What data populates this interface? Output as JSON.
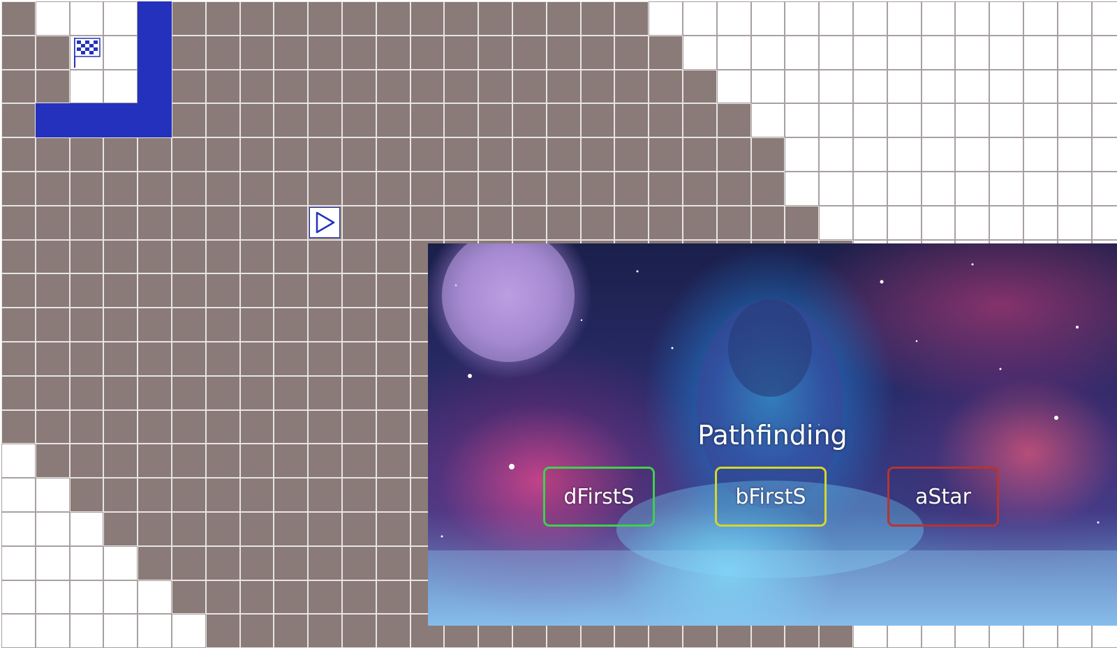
{
  "game": {
    "grid": {
      "cols": 33,
      "rows": 19,
      "visited_color": "#8a7b78",
      "open_color": "#ffffff",
      "wall_color": "#2431bd",
      "walls": [
        [
          4,
          0
        ],
        [
          4,
          1
        ],
        [
          4,
          2
        ],
        [
          1,
          3
        ],
        [
          2,
          3
        ],
        [
          3,
          3
        ],
        [
          4,
          3
        ]
      ],
      "visited_rows": [
        {
          "row": 0,
          "ranges": [
            [
              0,
              0
            ],
            [
              5,
              18
            ]
          ]
        },
        {
          "row": 1,
          "ranges": [
            [
              0,
              1
            ],
            [
              5,
              19
            ]
          ]
        },
        {
          "row": 2,
          "ranges": [
            [
              0,
              1
            ],
            [
              5,
              20
            ]
          ]
        },
        {
          "row": 3,
          "ranges": [
            [
              0,
              0
            ],
            [
              5,
              21
            ]
          ]
        },
        {
          "row": 4,
          "ranges": [
            [
              0,
              22
            ]
          ]
        },
        {
          "row": 5,
          "ranges": [
            [
              0,
              22
            ]
          ]
        },
        {
          "row": 6,
          "ranges": [
            [
              0,
              23
            ]
          ]
        },
        {
          "row": 7,
          "ranges": [
            [
              0,
              24
            ]
          ]
        },
        {
          "row": 8,
          "ranges": [
            [
              0,
              24
            ]
          ]
        },
        {
          "row": 9,
          "ranges": [
            [
              0,
              24
            ]
          ]
        },
        {
          "row": 10,
          "ranges": [
            [
              0,
              24
            ]
          ]
        },
        {
          "row": 11,
          "ranges": [
            [
              0,
              24
            ]
          ]
        },
        {
          "row": 12,
          "ranges": [
            [
              0,
              24
            ]
          ]
        },
        {
          "row": 13,
          "ranges": [
            [
              1,
              24
            ]
          ]
        },
        {
          "row": 14,
          "ranges": [
            [
              2,
              24
            ]
          ]
        },
        {
          "row": 15,
          "ranges": [
            [
              3,
              24
            ]
          ]
        },
        {
          "row": 16,
          "ranges": [
            [
              4,
              24
            ]
          ]
        },
        {
          "row": 17,
          "ranges": [
            [
              5,
              24
            ]
          ]
        },
        {
          "row": 18,
          "ranges": [
            [
              6,
              24
            ]
          ]
        }
      ],
      "start": {
        "cell": [
          9,
          6
        ],
        "icon": "play-triangle-icon",
        "color": "#2431bd"
      },
      "goal": {
        "cell": [
          2,
          1
        ],
        "icon": "checkered-flag-icon",
        "color": "#2431bd"
      }
    },
    "menu": {
      "title": "Pathfinding",
      "background": "lion-galaxy-artwork",
      "buttons": [
        {
          "label": "dFirstS",
          "border_color": "#3fd14a"
        },
        {
          "label": "bFirstS",
          "border_color": "#d6d62a"
        },
        {
          "label": "aStar",
          "border_color": "#b8332f"
        }
      ]
    }
  }
}
